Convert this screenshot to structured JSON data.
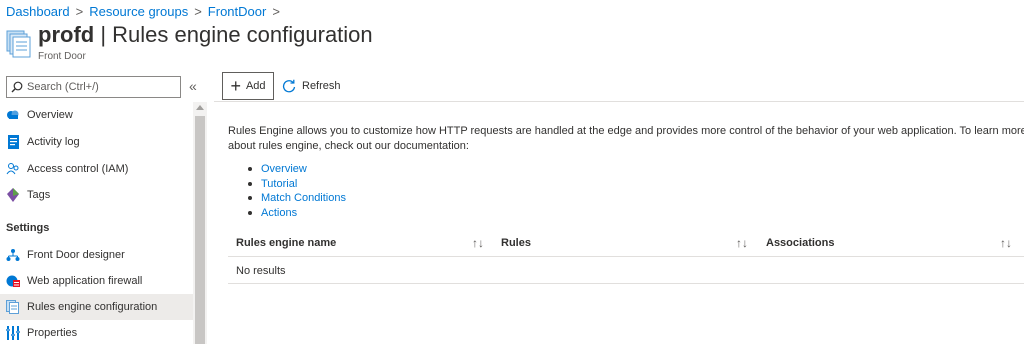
{
  "breadcrumb": {
    "items": [
      "Dashboard",
      "Resource groups",
      "FrontDoor"
    ]
  },
  "header": {
    "title_bold": "profd",
    "title_rest": " | Rules engine configuration",
    "subtitle": "Front Door"
  },
  "sidebar": {
    "search_placeholder": "Search (Ctrl+/)",
    "collapse_glyph": "«",
    "items": [
      {
        "label": "Overview",
        "icon": "cloud-icon"
      },
      {
        "label": "Activity log",
        "icon": "activity-log-icon"
      },
      {
        "label": "Access control (IAM)",
        "icon": "people-icon"
      },
      {
        "label": "Tags",
        "icon": "tag-icon"
      }
    ],
    "section": "Settings",
    "settings_items": [
      {
        "label": "Front Door designer",
        "icon": "designer-icon"
      },
      {
        "label": "Web application firewall",
        "icon": "firewall-icon"
      },
      {
        "label": "Rules engine configuration",
        "icon": "rules-icon",
        "active": true
      },
      {
        "label": "Properties",
        "icon": "properties-icon"
      }
    ]
  },
  "toolbar": {
    "add_label": "Add",
    "refresh_label": "Refresh"
  },
  "main": {
    "description": "Rules Engine allows you to customize how HTTP requests are handled at the edge and provides more control of the behavior of your web application. To learn more about rules engine, check out our documentation:",
    "doc_links": [
      "Overview",
      "Tutorial",
      "Match Conditions",
      "Actions"
    ],
    "table": {
      "columns": [
        "Rules engine name",
        "Rules",
        "Associations"
      ],
      "sort_glyph": "↑↓",
      "empty_text": "No results"
    }
  },
  "colors": {
    "accent": "#0078d4",
    "active_bg": "#edebe9"
  }
}
